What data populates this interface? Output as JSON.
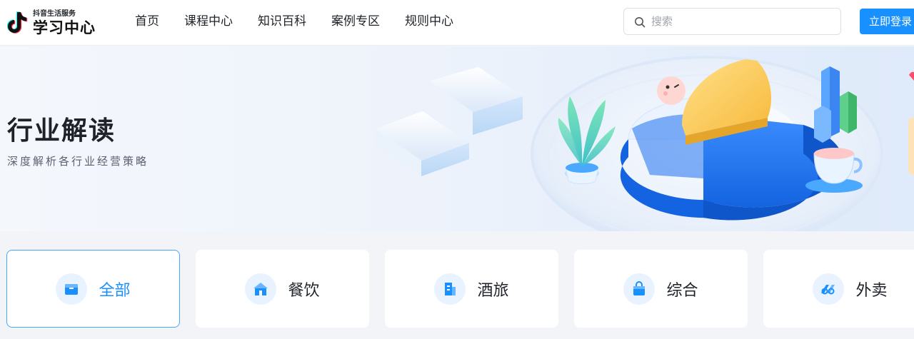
{
  "header": {
    "logo_small": "抖音生活服务",
    "logo_big": "学习中心",
    "nav": [
      "首页",
      "课程中心",
      "知识百科",
      "案例专区",
      "规则中心"
    ],
    "search_placeholder": "搜索",
    "login_label": "立即登录"
  },
  "banner": {
    "title": "行业解读",
    "subtitle": "深度解析各行业经营策略"
  },
  "categories": [
    {
      "label": "全部",
      "icon": "box-icon",
      "active": true
    },
    {
      "label": "餐饮",
      "icon": "house-icon",
      "active": false
    },
    {
      "label": "酒旅",
      "icon": "building-icon",
      "active": false
    },
    {
      "label": "综合",
      "icon": "bag-icon",
      "active": false
    },
    {
      "label": "外卖",
      "icon": "delivery-icon",
      "active": false
    }
  ],
  "colors": {
    "primary": "#1890ff",
    "active_border": "#4aa4ff",
    "icon_bg": "#e8f3ff"
  }
}
